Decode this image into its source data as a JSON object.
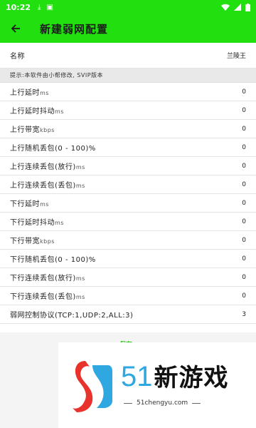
{
  "status_bar": {
    "time": "10:22"
  },
  "header": {
    "title": "新建弱网配置"
  },
  "form": {
    "name_label": "名称",
    "name_value": "兰陵王",
    "tip": "提示:本软件由小帮修改, SVIP版本",
    "rows": [
      {
        "label": "上行延时",
        "unit": "ms",
        "value": "0"
      },
      {
        "label": "上行延时抖动",
        "unit": "ms",
        "value": "0"
      },
      {
        "label": "上行带宽",
        "unit": "kbps",
        "value": "0"
      },
      {
        "label": "上行随机丢包(0 - 100)%",
        "unit": "",
        "value": "0"
      },
      {
        "label": "上行连续丢包(放行)",
        "unit": "ms",
        "value": "0"
      },
      {
        "label": "上行连续丢包(丢包)",
        "unit": "ms",
        "value": "0"
      },
      {
        "label": "下行延时",
        "unit": "ms",
        "value": "0"
      },
      {
        "label": "下行延时抖动",
        "unit": "ms",
        "value": "0"
      },
      {
        "label": "下行带宽",
        "unit": "kbps",
        "value": "0"
      },
      {
        "label": "下行随机丢包(0 - 100)%",
        "unit": "",
        "value": "0"
      },
      {
        "label": "下行连续丢包(放行)",
        "unit": "ms",
        "value": "0"
      },
      {
        "label": "下行连续丢包(丢包)",
        "unit": "ms",
        "value": "0"
      },
      {
        "label": "弱网控制协议(TCP:1,UDP:2,ALL:3)",
        "unit": "",
        "value": "3"
      }
    ],
    "save_label": "保存"
  },
  "watermark": {
    "brand_number": "51",
    "brand_name": "新游戏",
    "url": "51chengyu.com"
  },
  "colors": {
    "accent": "#22e00f",
    "brand_blue": "#2fa7e0",
    "brand_red": "#e8322c"
  }
}
